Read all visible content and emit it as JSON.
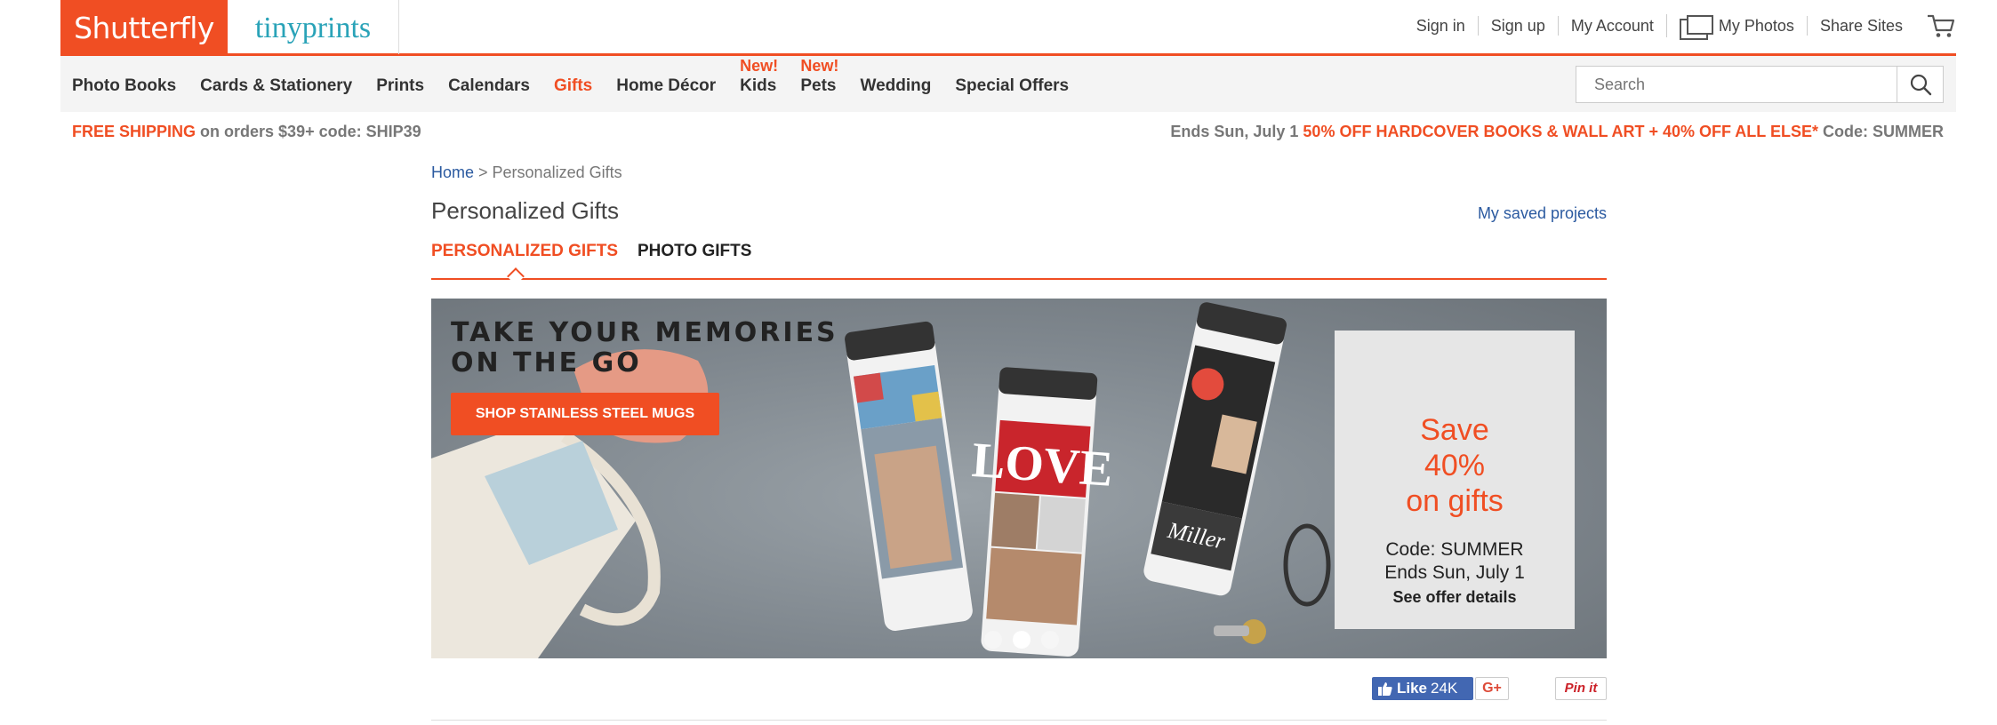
{
  "header": {
    "logo_shutterfly": "Shutterfly",
    "logo_tinyprints": "tinyprints",
    "links": {
      "sign_in": "Sign in",
      "sign_up": "Sign up",
      "my_account": "My Account",
      "my_photos": "My Photos",
      "share_sites": "Share Sites"
    }
  },
  "nav": {
    "items": [
      {
        "label": "Photo Books"
      },
      {
        "label": "Cards & Stationery"
      },
      {
        "label": "Prints"
      },
      {
        "label": "Calendars"
      },
      {
        "label": "Gifts",
        "active": true
      },
      {
        "label": "Home Décor"
      },
      {
        "label": "Kids",
        "badge": "New!"
      },
      {
        "label": "Pets",
        "badge": "New!"
      },
      {
        "label": "Wedding"
      },
      {
        "label": "Special Offers"
      }
    ],
    "search_placeholder": "Search"
  },
  "promo": {
    "left_highlight": "FREE SHIPPING",
    "left_text": " on orders $39+ code: SHIP39",
    "right_prefix": "Ends Sun, July 1 ",
    "right_highlight": "50% OFF HARDCOVER BOOKS & WALL ART + 40% OFF ALL ELSE*",
    "right_suffix": " Code: SUMMER"
  },
  "page": {
    "breadcrumb_home": "Home",
    "breadcrumb_sep": " > ",
    "breadcrumb_current": "Personalized Gifts",
    "title": "Personalized Gifts",
    "saved_projects": "My saved projects",
    "tabs": [
      {
        "label": "PERSONALIZED GIFTS",
        "active": true
      },
      {
        "label": "PHOTO GIFTS",
        "active": false
      }
    ]
  },
  "hero": {
    "title": "TAKE YOUR MEMORIES\nON THE GO",
    "button": "SHOP STAINLESS STEEL MUGS",
    "mug_love_text": "LOVE",
    "mug_name_text": "Miller",
    "offer_save": "Save\n40%\non gifts",
    "offer_code": "Code: SUMMER",
    "offer_ends": "Ends Sun, July 1",
    "offer_details": "See offer details",
    "slides_count": 3,
    "active_slide": 2
  },
  "social": {
    "fb_like": "Like",
    "fb_count": "24K",
    "gplus": "G+",
    "pinit": "Pin it"
  },
  "colors": {
    "brand_orange": "#f04e23",
    "tinyprints_teal": "#2aa3b8",
    "link_blue": "#2b5aa0",
    "facebook_blue": "#4267b2"
  }
}
